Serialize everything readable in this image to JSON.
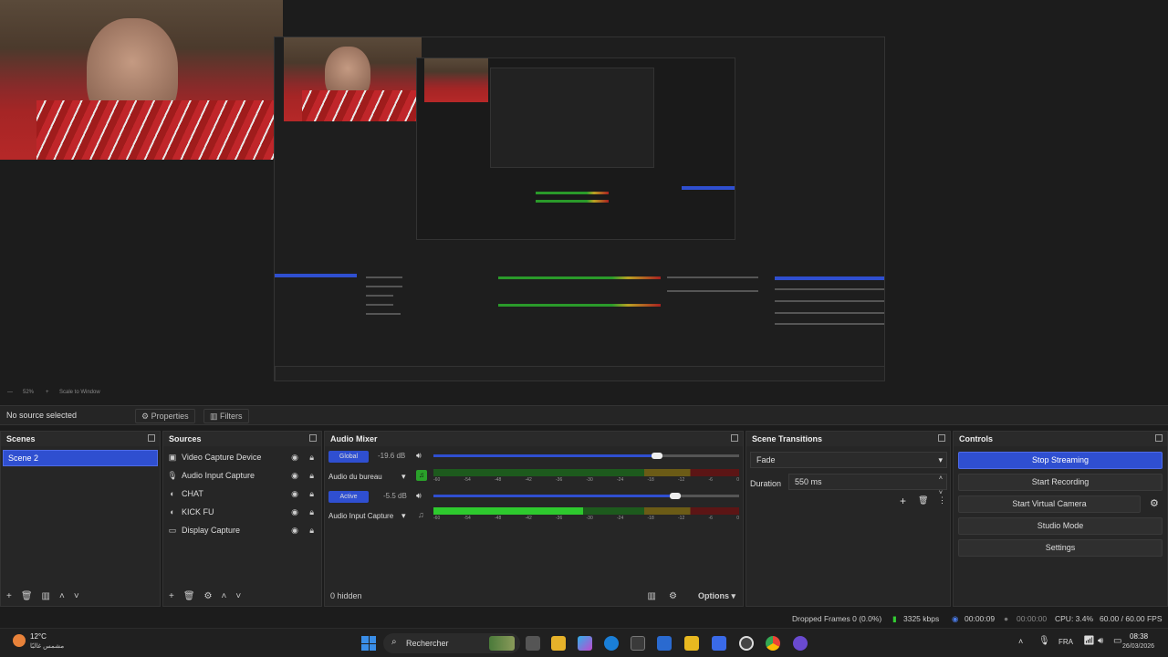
{
  "window": {
    "controls": [
      "—",
      "❐",
      "✕"
    ]
  },
  "preview": {
    "zoom": "52%",
    "scale_label": "Scale to Window"
  },
  "source_bar": {
    "no_source": "No source selected",
    "properties": "Properties",
    "filters": "Filters"
  },
  "scenes": {
    "title": "Scenes",
    "items": [
      "Scene 2"
    ]
  },
  "sources": {
    "title": "Sources",
    "items": [
      {
        "icon": "camera-icon",
        "label": "Video Capture Device"
      },
      {
        "icon": "microphone-icon",
        "label": "Audio Input Capture"
      },
      {
        "icon": "browser-icon",
        "label": "CHAT"
      },
      {
        "icon": "browser-icon",
        "label": "KICK FU"
      },
      {
        "icon": "monitor-icon",
        "label": "Display Capture"
      }
    ]
  },
  "mixer": {
    "title": "Audio Mixer",
    "channels": [
      {
        "pill": "Global",
        "db": "-19.6 dB",
        "name": "Audio du bureau",
        "volume": 0.73,
        "level": 0.0
      },
      {
        "pill": "Active",
        "db": "-5.5 dB",
        "name": "Audio Input Capture",
        "volume": 0.79,
        "level": 0.49
      }
    ],
    "scale": [
      "-60",
      "-54",
      "-48",
      "-42",
      "-36",
      "-30",
      "-24",
      "-18",
      "-12",
      "-6",
      "0"
    ],
    "hidden": "0 hidden",
    "options": "Options"
  },
  "transitions": {
    "title": "Scene Transitions",
    "type": "Fade",
    "duration_label": "Duration",
    "duration_value": "550 ms"
  },
  "controls": {
    "title": "Controls",
    "buttons": [
      "Stop Streaming",
      "Start Recording",
      "Start Virtual Camera",
      "Studio Mode",
      "Settings"
    ]
  },
  "status": {
    "dropped": "Dropped Frames 0 (0.0%)",
    "bitrate": "3325 kbps",
    "stream_time": "00:00:09",
    "rec_time": "00:00:00",
    "cpu": "CPU: 3.4%",
    "fps": "60.00 / 60.00 FPS"
  },
  "taskbar": {
    "weather_temp": "12°C",
    "weather_desc": "مشمس غالبًا",
    "search": "Rechercher",
    "lang": "FRA",
    "time": "08:38",
    "date": "26/03/2026"
  }
}
